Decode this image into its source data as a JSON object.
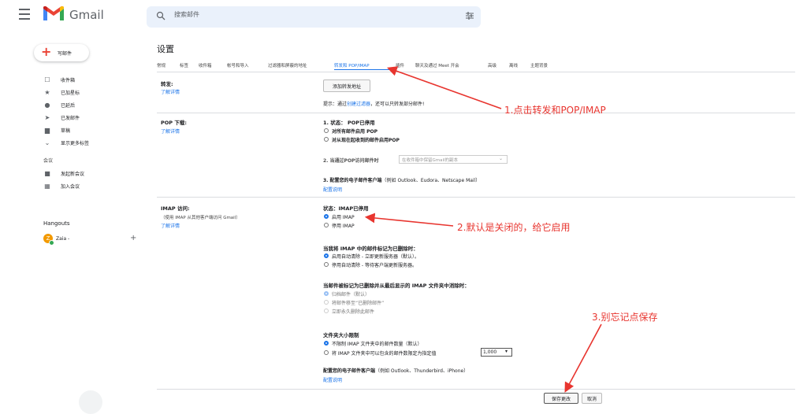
{
  "app": {
    "name": "Gmail"
  },
  "search": {
    "placeholder": "搜索邮件"
  },
  "compose": {
    "label": "写邮件"
  },
  "sidebar": {
    "items": [
      {
        "label": "收件箱",
        "icon": "inbox-icon"
      },
      {
        "label": "已加星标",
        "icon": "star-icon"
      },
      {
        "label": "已延后",
        "icon": "clock-icon"
      },
      {
        "label": "已发邮件",
        "icon": "send-icon"
      },
      {
        "label": "草稿",
        "icon": "draft-icon"
      },
      {
        "label": "显示更多标签",
        "icon": "chevron-down-icon"
      }
    ],
    "meet_header": "会议",
    "meet_items": [
      {
        "label": "发起新会议",
        "icon": "video-icon"
      },
      {
        "label": "加入会议",
        "icon": "keyboard-icon"
      }
    ],
    "hangouts_header": "Hangouts",
    "user": {
      "initial": "Z",
      "name": "Zaia -"
    }
  },
  "settings": {
    "title": "设置",
    "tabs": [
      "常规",
      "标签",
      "收件箱",
      "帐号和导入",
      "过滤器和屏蔽的地址",
      "转发和 POP/IMAP",
      "插件",
      "聊天及通过 Meet 开会",
      "高级",
      "离线",
      "主题背景"
    ],
    "active_tab": "转发和 POP/IMAP",
    "forwarding": {
      "label": "转发:",
      "learn_more": "了解详情",
      "add_button": "添加转发地址",
      "tip_prefix": "提示：通过",
      "tip_link": "创建过滤器",
      "tip_suffix": "，还可以只转发部分邮件!"
    },
    "pop": {
      "label": "POP 下载:",
      "learn_more": "了解详情",
      "status": "1. 状态：  POP已停用",
      "options": [
        "对所有邮件启用 POP",
        "对从现在起收到的邮件启用POP"
      ],
      "step2": "2. 当通过POP访问邮件时",
      "step2_select": "在收件箱中保留Gmail的副本",
      "step3_bold": "3. 配置您的电子邮件客户端",
      "step3_rest": "（例如 Outlook、Eudora、Netscape Mail）",
      "config_link": "配置说明"
    },
    "imap": {
      "label": "IMAP 访问:",
      "sub": "（使用 IMAP 从其他客户端访问 Gmail）",
      "learn_more": "了解详情",
      "status": "状态：IMAP已停用",
      "options": [
        "启用 IMAP",
        "停用 IMAP"
      ],
      "mark_deleted_title": "当我将 IMAP 中的邮件标记为已删除时：",
      "mark_deleted_options": [
        "启用自动清除 - 立即更新服务器（默认）。",
        "停用自动清除 - 等待客户端更新服务器。"
      ],
      "expunge_title": "当邮件被标记为已删除并从最后显示的 IMAP 文件夹中消除时：",
      "expunge_options": [
        "归档邮件（默认）",
        "将邮件移至“已删除邮件”",
        "立即永久删除此邮件"
      ],
      "folder_title": "文件夹大小限制",
      "folder_options": [
        "不限制 IMAP 文件夹中的邮件数量（默认）",
        "将 IMAP 文件夹中可以包含的邮件数限定为指定值"
      ],
      "folder_limit": "1,000",
      "client_bold": "配置您的电子邮件客户端",
      "client_rest": "（例如 Outlook、Thunderbird、iPhone）",
      "config_link": "配置说明"
    },
    "save_button": "保存更改",
    "cancel_button": "取消"
  },
  "annotations": [
    "1.点击转发和POP/IMAP",
    "2.默认是关闭的，给它启用",
    "3.别忘记点保存"
  ],
  "colors": {
    "accent": "#1a73e8",
    "annotation": "#e8352f",
    "gmail_red": "#ea4335"
  }
}
